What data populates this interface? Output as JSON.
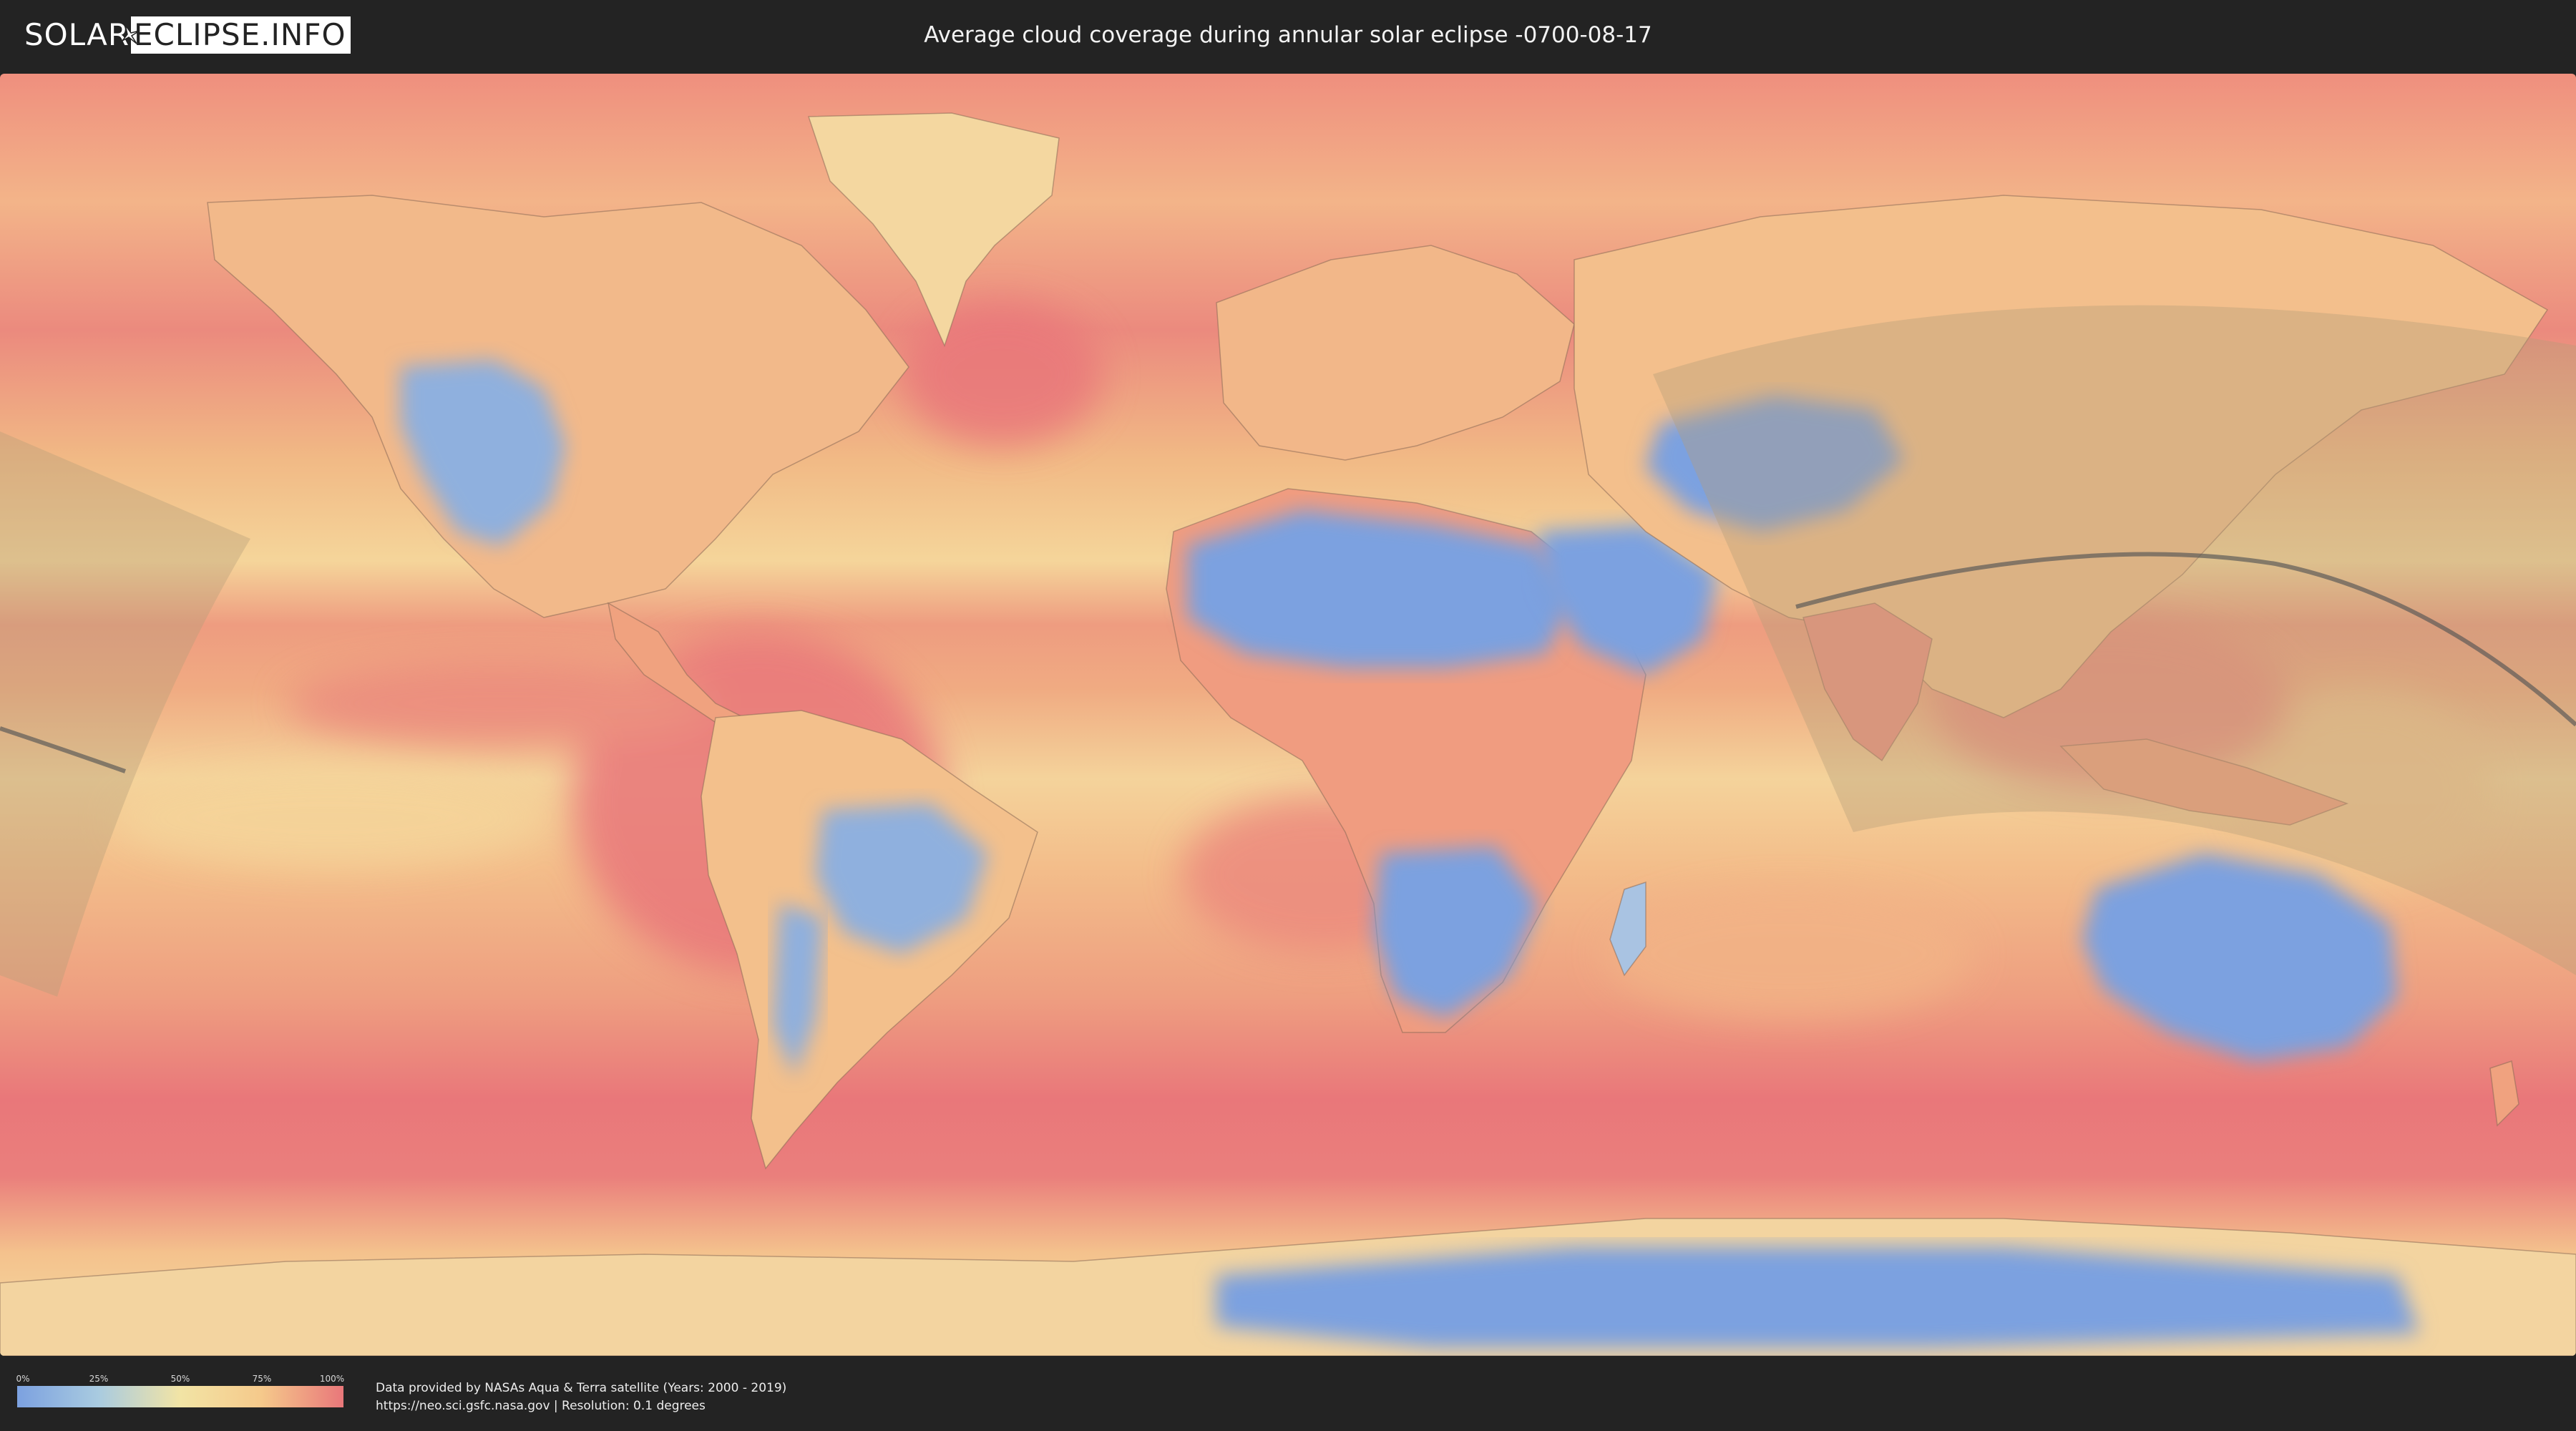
{
  "header": {
    "logo_solar": "SOLAR",
    "logo_eclipse": "ECLIPSE.INFO",
    "title": "Average cloud coverage during annular solar eclipse -0700-08-17"
  },
  "legend": {
    "ticks": [
      "0%",
      "25%",
      "50%",
      "75%",
      "100%"
    ],
    "colors": [
      "#7ca1e0",
      "#a9cbe0",
      "#f2e4a5",
      "#f5c98b",
      "#e9777a"
    ]
  },
  "footer": {
    "credit_line1": "Data provided by NASAs Aqua & Terra satellite (Years: 2000 - 2019)",
    "credit_line2": "https://neo.sci.gsfc.nasa.gov | Resolution: 0.1 degrees"
  },
  "map": {
    "colors": {
      "high_cloud": "#e9777a",
      "mid_cloud": "#f3a47c",
      "low_mid_cloud": "#f2dc9c",
      "low_cloud": "#7ca1e0",
      "eclipse_band": "#b59d78",
      "central_line": "#555555",
      "border_line": "#8a6a55"
    }
  }
}
